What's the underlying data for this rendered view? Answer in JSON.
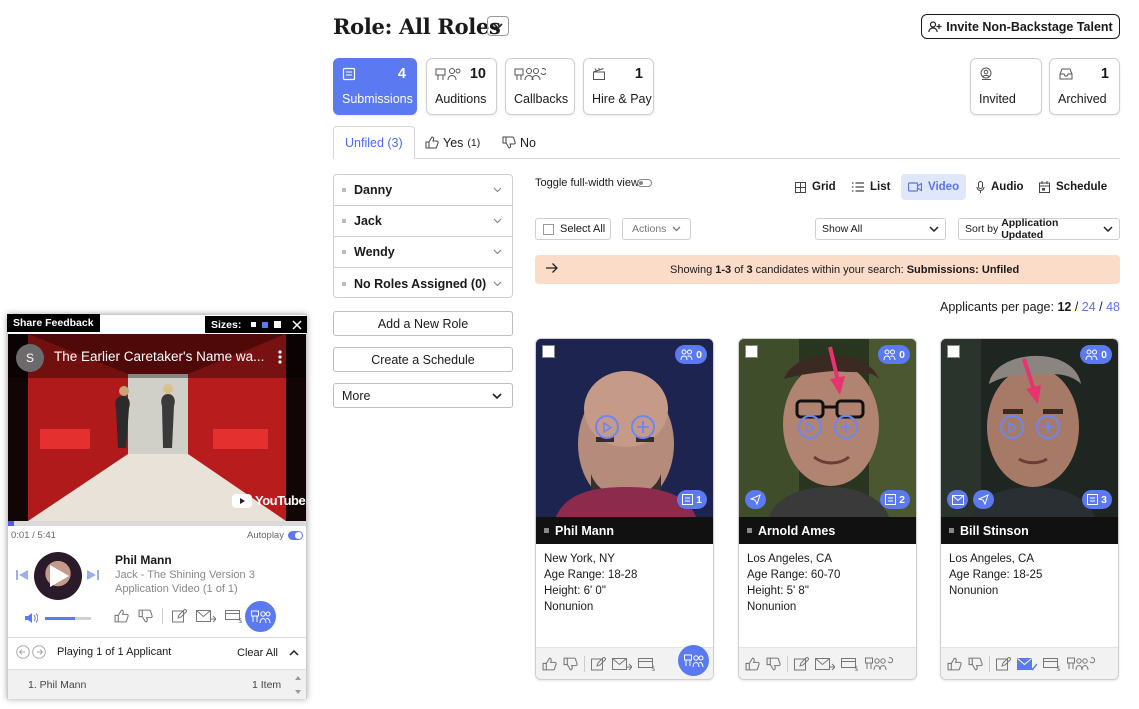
{
  "header": {
    "title": "Role: All Roles",
    "invite_label": "Invite Non-Backstage Talent"
  },
  "stages": [
    {
      "label": "Submissions",
      "count": "4",
      "icon": "clipboard-icon",
      "active": true
    },
    {
      "label": "Auditions",
      "count": "10",
      "icon": "audition-icon"
    },
    {
      "label": "Callbacks",
      "count": "",
      "icon": "callback-icon"
    },
    {
      "label": "Hire & Pay",
      "count": "1",
      "icon": "clapperboard-icon"
    },
    {
      "label": "Invited",
      "count": "",
      "icon": "invited-icon"
    },
    {
      "label": "Archived",
      "count": "1",
      "icon": "archive-tray-icon"
    }
  ],
  "tabs": {
    "unfiled": "Unfiled (3)",
    "yes": "Yes",
    "yes_count": "(1)",
    "no": "No"
  },
  "roles": [
    "Danny",
    "Jack",
    "Wendy",
    "No Roles Assigned (0)"
  ],
  "side_buttons": {
    "add_role": "Add a New Role",
    "schedule": "Create a Schedule",
    "more": "More"
  },
  "toolbar": {
    "toggle_label": "Toggle full-width view",
    "views": [
      "Grid",
      "List",
      "Video",
      "Audio",
      "Schedule"
    ],
    "active_view": "Video",
    "select_all": "Select All",
    "actions": "Actions",
    "show_all": "Show All",
    "sort_prefix": "Sort by",
    "sort_value": "Application Updated"
  },
  "banner": {
    "showing": "Showing",
    "range": "1-3",
    "of": "of",
    "total": "3",
    "suffix": "candidates within your search:",
    "filter": "Submissions: Unfiled"
  },
  "per_page": {
    "label": "Applicants per page:",
    "current": "12",
    "opt2": "24",
    "opt3": "48"
  },
  "candidates": [
    {
      "name": "Phil Mann",
      "location": "New York, NY",
      "age": "Age Range: 18-28",
      "height": "Height: 6' 0\"",
      "union": "Nonunion",
      "badge_top": "0",
      "badge_bottom": "1"
    },
    {
      "name": "Arnold Ames",
      "location": "Los Angeles, CA",
      "age": "Age Range: 60-70",
      "height": "Height: 5' 8\"",
      "union": "Nonunion",
      "badge_top": "0",
      "badge_bottom": "2"
    },
    {
      "name": "Bill Stinson",
      "location": "Los Angeles, CA",
      "age": "Age Range: 18-25",
      "union": "Nonunion",
      "badge_top": "0",
      "badge_bottom": "3"
    }
  ],
  "player": {
    "share_feedback": "Share Feedback",
    "sizes_label": "Sizes:",
    "video_title": "The Earlier Caretaker's Name wa...",
    "channel_initial": "S",
    "youtube": "YouTube",
    "time": "0:01 / 5:41",
    "autoplay": "Autoplay",
    "now_name": "Phil Mann",
    "now_role": "Jack - The Shining Version 3",
    "now_sub": "Application Video (1 of 1)",
    "playing": "Playing 1 of 1 Applicant",
    "clear_all": "Clear All",
    "queue_item": "1. Phil Mann",
    "queue_count": "1 Item",
    "progress": 0.003
  },
  "colors": {
    "accent": "#5b79f0",
    "banner": "#fbdcc8",
    "annotation_arrow": "#e8336f"
  }
}
